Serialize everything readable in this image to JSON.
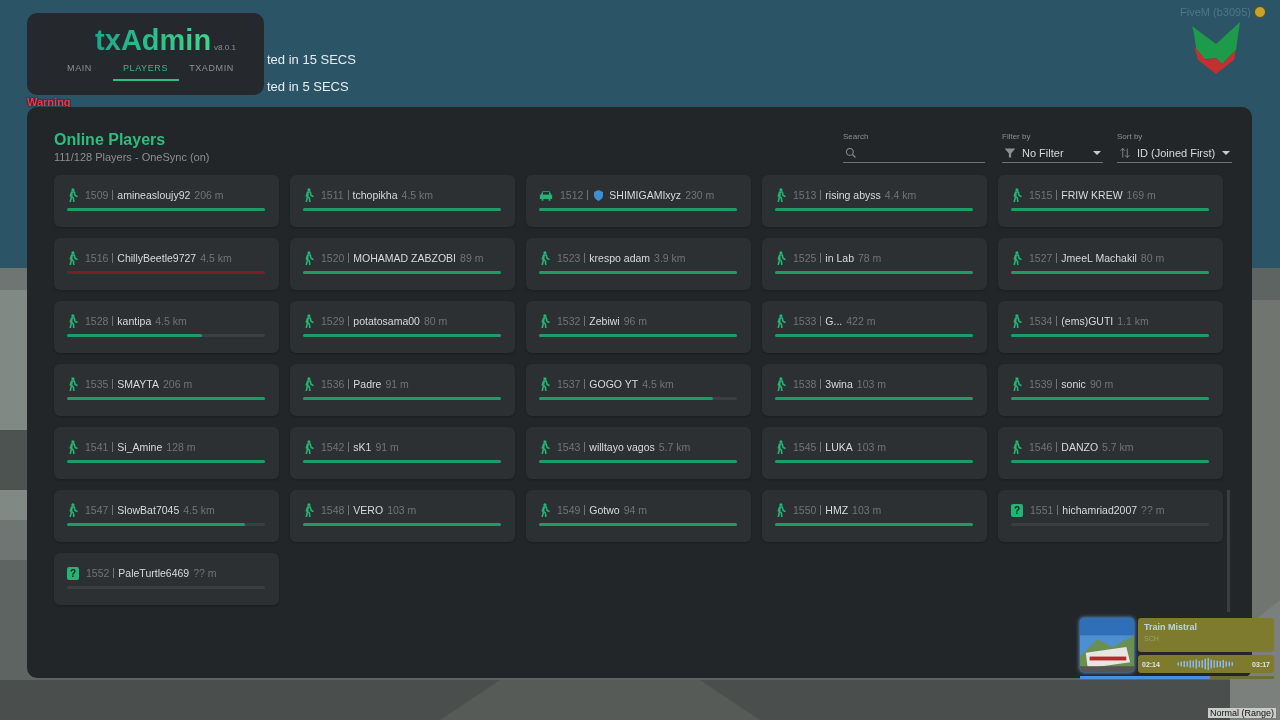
{
  "background_texts": [
    {
      "kind": "notice",
      "text": "ted in 15 SECS"
    },
    {
      "kind": "notice",
      "text": "ted in 5 SECS"
    },
    {
      "kind": "warning",
      "text": "Warning"
    }
  ],
  "game_version": "FiveM (b3095)",
  "menu": {
    "logo": "txAdmin",
    "version": "v8.0.1",
    "tabs": [
      {
        "label": "MAIN",
        "selected": false
      },
      {
        "label": "PLAYERS",
        "selected": true
      },
      {
        "label": "TXADMIN",
        "selected": false
      }
    ]
  },
  "panel": {
    "title": "Online Players",
    "subtitle": "111/128 Players - OneSync (on)",
    "search": {
      "label": "Search"
    },
    "filter": {
      "label": "Filter by",
      "value": "No Filter"
    },
    "sort": {
      "label": "Sort by",
      "value": "ID (Joined First)"
    },
    "players": [
      {
        "kind": "walk",
        "id": "1509",
        "name": "amineasloujy92",
        "distance": "206 m",
        "badge": false,
        "level": 1,
        "color": "#1e9c66"
      },
      {
        "kind": "walk",
        "id": "1511",
        "name": "tchopikha",
        "distance": "4.5 km",
        "badge": false,
        "level": 1,
        "color": "#1e9c66"
      },
      {
        "kind": "car",
        "id": "1512",
        "name": "SHIMIGAMIxyz",
        "distance": "230 m",
        "badge": true,
        "level": 1,
        "color": "#1e9c66"
      },
      {
        "kind": "walk",
        "id": "1513",
        "name": "rising abyss",
        "distance": "4.4 km",
        "badge": false,
        "level": 1,
        "color": "#1e9c66"
      },
      {
        "kind": "walk",
        "id": "1515",
        "name": "FRIW KREW",
        "distance": "169 m",
        "badge": false,
        "level": 1,
        "color": "#1e9c66"
      },
      {
        "kind": "walk",
        "id": "1516",
        "name": "ChillyBeetle9727",
        "distance": "4.5 km",
        "badge": false,
        "level": 1,
        "color": "#7a1c2c"
      },
      {
        "kind": "walk",
        "id": "1520",
        "name": "MOHAMAD ZABZOBI",
        "distance": "89 m",
        "badge": false,
        "level": 1,
        "color": "#1e9c66"
      },
      {
        "kind": "walk",
        "id": "1523",
        "name": "krespo adam",
        "distance": "3.9 km",
        "badge": false,
        "level": 1,
        "color": "#1e9c66"
      },
      {
        "kind": "walk",
        "id": "1525",
        "name": "in Lab",
        "distance": "78 m",
        "badge": false,
        "level": 1,
        "color": "#1e9c66"
      },
      {
        "kind": "walk",
        "id": "1527",
        "name": "JmeeL Machakil",
        "distance": "80 m",
        "badge": false,
        "level": 1,
        "color": "#1e9c66"
      },
      {
        "kind": "walk",
        "id": "1528",
        "name": "kantipa",
        "distance": "4.5 km",
        "badge": false,
        "level": 0.68,
        "color": "#1e9c66"
      },
      {
        "kind": "walk",
        "id": "1529",
        "name": "potatosama00",
        "distance": "80 m",
        "badge": false,
        "level": 1,
        "color": "#1e9c66"
      },
      {
        "kind": "walk",
        "id": "1532",
        "name": "Zebiwi",
        "distance": "96 m",
        "badge": false,
        "level": 1,
        "color": "#1e9c66"
      },
      {
        "kind": "walk",
        "id": "1533",
        "name": "G...",
        "distance": "422 m",
        "badge": false,
        "level": 1,
        "color": "#1e9c66"
      },
      {
        "kind": "walk",
        "id": "1534",
        "name": "(ems)GUTI",
        "distance": "1.1 km",
        "badge": false,
        "level": 1,
        "color": "#1e9c66"
      },
      {
        "kind": "walk",
        "id": "1535",
        "name": "SMAYTA",
        "distance": "206 m",
        "badge": false,
        "level": 1,
        "color": "#1e9c66"
      },
      {
        "kind": "walk",
        "id": "1536",
        "name": "Padre",
        "distance": "91 m",
        "badge": false,
        "level": 1,
        "color": "#1e9c66"
      },
      {
        "kind": "walk",
        "id": "1537",
        "name": "GOGO YT",
        "distance": "4.5 km",
        "badge": false,
        "level": 0.88,
        "color": "#1e9c66"
      },
      {
        "kind": "walk",
        "id": "1538",
        "name": "3wina",
        "distance": "103 m",
        "badge": false,
        "level": 1,
        "color": "#1e9c66"
      },
      {
        "kind": "walk",
        "id": "1539",
        "name": "sonic",
        "distance": "90 m",
        "badge": false,
        "level": 1,
        "color": "#1e9c66"
      },
      {
        "kind": "walk",
        "id": "1541",
        "name": "Si_Amine",
        "distance": "128 m",
        "badge": false,
        "level": 1,
        "color": "#1e9c66"
      },
      {
        "kind": "walk",
        "id": "1542",
        "name": "sK1",
        "distance": "91 m",
        "badge": false,
        "level": 1,
        "color": "#1e9c66"
      },
      {
        "kind": "walk",
        "id": "1543",
        "name": "willtayo vagos",
        "distance": "5.7 km",
        "badge": false,
        "level": 1,
        "color": "#1e9c66"
      },
      {
        "kind": "walk",
        "id": "1545",
        "name": "LUKA",
        "distance": "103 m",
        "badge": false,
        "level": 1,
        "color": "#1e9c66"
      },
      {
        "kind": "walk",
        "id": "1546",
        "name": "DANZO",
        "distance": "5.7 km",
        "badge": false,
        "level": 1,
        "color": "#1e9c66"
      },
      {
        "kind": "walk",
        "id": "1547",
        "name": "SlowBat7045",
        "distance": "4.5 km",
        "badge": false,
        "level": 0.9,
        "color": "#1e9c66"
      },
      {
        "kind": "walk",
        "id": "1548",
        "name": "VERO",
        "distance": "103 m",
        "badge": false,
        "level": 1,
        "color": "#1e9c66"
      },
      {
        "kind": "walk",
        "id": "1549",
        "name": "Gotwo",
        "distance": "94 m",
        "badge": false,
        "level": 1,
        "color": "#1e9c66"
      },
      {
        "kind": "walk",
        "id": "1550",
        "name": "HMZ",
        "distance": "103 m",
        "badge": false,
        "level": 1,
        "color": "#1e9c66"
      },
      {
        "kind": "unknown",
        "icon": "?",
        "id": "1551",
        "name": "hichamriad2007",
        "distance": "?? m",
        "badge": false
      },
      {
        "kind": "unknown",
        "icon": "?",
        "id": "1552",
        "name": "PaleTurtle6469",
        "distance": "?? m",
        "badge": false
      }
    ]
  },
  "music": {
    "title": "Train Mistral",
    "artist": "SCH",
    "elapsed": "02:14",
    "total": "03:17",
    "level": 0.67
  },
  "voice_mode": "Normal (Range)"
}
